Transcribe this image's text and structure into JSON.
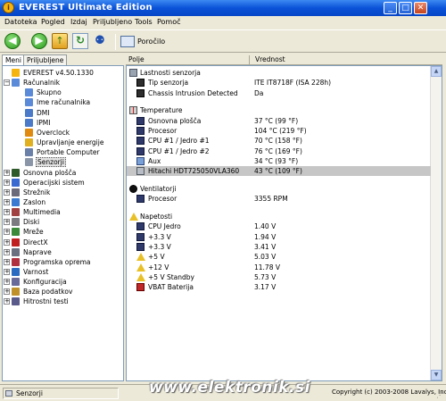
{
  "window": {
    "title": "EVEREST Ultimate Edition",
    "app_icon": "i"
  },
  "window_buttons": {
    "minimize": "_",
    "maximize": "□",
    "close": "✕"
  },
  "menu": [
    "Datoteka",
    "Pogled",
    "Izdaj",
    "Priljubljeno",
    "Tools",
    "Pomoč"
  ],
  "toolbar": {
    "back": "◀",
    "forward": "▶",
    "up": "↑",
    "refresh": "↻",
    "users": "⚉",
    "report_label": "Poročilo"
  },
  "tabs": [
    "Meni",
    "Priljubljene"
  ],
  "tree": [
    {
      "label": "EVEREST v4.50.1330",
      "icon": "everest-icon",
      "depth": 0,
      "expander": ""
    },
    {
      "label": "Računalnik",
      "icon": "computer-icon",
      "depth": 0,
      "expander": "−"
    },
    {
      "label": "Skupno",
      "icon": "computer-icon",
      "depth": 1,
      "expander": ""
    },
    {
      "label": "Ime računalnika",
      "icon": "computer-icon",
      "depth": 1,
      "expander": ""
    },
    {
      "label": "DMI",
      "icon": "dmi-icon",
      "depth": 1,
      "expander": ""
    },
    {
      "label": "IPMI",
      "icon": "ipmi-icon",
      "depth": 1,
      "expander": ""
    },
    {
      "label": "Overclock",
      "icon": "overclock-icon",
      "depth": 1,
      "expander": ""
    },
    {
      "label": "Upravljanje energije",
      "icon": "power-icon",
      "depth": 1,
      "expander": ""
    },
    {
      "label": "Portable Computer",
      "icon": "laptop-icon",
      "depth": 1,
      "expander": ""
    },
    {
      "label": "Senzorji",
      "icon": "sensor-icon",
      "depth": 1,
      "expander": "",
      "selected": true
    },
    {
      "label": "Osnovna plošča",
      "icon": "motherboard-icon",
      "depth": 0,
      "expander": "+"
    },
    {
      "label": "Operacijski sistem",
      "icon": "os-icon",
      "depth": 0,
      "expander": "+"
    },
    {
      "label": "Strežnik",
      "icon": "server-icon",
      "depth": 0,
      "expander": "+"
    },
    {
      "label": "Zaslon",
      "icon": "display-icon",
      "depth": 0,
      "expander": "+"
    },
    {
      "label": "Multimedia",
      "icon": "multimedia-icon",
      "depth": 0,
      "expander": "+"
    },
    {
      "label": "Diski",
      "icon": "disk-icon",
      "depth": 0,
      "expander": "+"
    },
    {
      "label": "Mreže",
      "icon": "network-icon",
      "depth": 0,
      "expander": "+"
    },
    {
      "label": "DirectX",
      "icon": "directx-icon",
      "depth": 0,
      "expander": "+"
    },
    {
      "label": "Naprave",
      "icon": "devices-icon",
      "depth": 0,
      "expander": "+"
    },
    {
      "label": "Programska oprema",
      "icon": "software-icon",
      "depth": 0,
      "expander": "+"
    },
    {
      "label": "Varnost",
      "icon": "security-icon",
      "depth": 0,
      "expander": "+"
    },
    {
      "label": "Konfiguracija",
      "icon": "config-icon",
      "depth": 0,
      "expander": "+"
    },
    {
      "label": "Baza podatkov",
      "icon": "database-icon",
      "depth": 0,
      "expander": "+"
    },
    {
      "label": "Hitrostni testi",
      "icon": "benchmark-icon",
      "depth": 0,
      "expander": "+"
    }
  ],
  "columns": {
    "field": "Polje",
    "value": "Vrednost"
  },
  "sections": [
    {
      "title": "Lastnosti senzorja",
      "icon": "sensor-icon",
      "rows": [
        {
          "field": "Tip senzorja",
          "value": "ITE IT8718F (ISA 228h)",
          "icon": "chip-icon"
        },
        {
          "field": "Chassis Intrusion Detected",
          "value": "Da",
          "icon": "chip-icon"
        }
      ]
    },
    {
      "title": "Temperature",
      "icon": "thermometer-icon",
      "rows": [
        {
          "field": "Osnovna plošča",
          "value": "37 °C  (99 °F)",
          "icon": "board-icon"
        },
        {
          "field": "Procesor",
          "value": "104 °C  (219 °F)",
          "icon": "board-icon"
        },
        {
          "field": "CPU #1 / Jedro #1",
          "value": "70 °C  (158 °F)",
          "icon": "board-icon"
        },
        {
          "field": "CPU #1 / Jedro #2",
          "value": "76 °C  (169 °F)",
          "icon": "board-icon"
        },
        {
          "field": "Aux",
          "value": "34 °C  (93 °F)",
          "icon": "aux-icon"
        },
        {
          "field": "Hitachi HDT725050VLA360",
          "value": "43 °C  (109 °F)",
          "icon": "hdd-icon",
          "highlighted": true
        }
      ]
    },
    {
      "title": "Ventilatorji",
      "icon": "fan-icon",
      "rows": [
        {
          "field": "Procesor",
          "value": "3355 RPM",
          "icon": "board-icon"
        }
      ]
    },
    {
      "title": "Napetosti",
      "icon": "voltage-icon",
      "rows": [
        {
          "field": "CPU Jedro",
          "value": "1.40 V",
          "icon": "board-icon"
        },
        {
          "field": "+3.3 V",
          "value": "1.94 V",
          "icon": "board-icon"
        },
        {
          "field": "+3.3 V",
          "value": "3.41 V",
          "icon": "board-icon"
        },
        {
          "field": "+5 V",
          "value": "5.03 V",
          "icon": "warning-icon"
        },
        {
          "field": "+12 V",
          "value": "11.78 V",
          "icon": "warning-icon"
        },
        {
          "field": "+5 V Standby",
          "value": "5.73 V",
          "icon": "warning-icon"
        },
        {
          "field": "VBAT Baterija",
          "value": "3.17 V",
          "icon": "battery-icon"
        }
      ]
    }
  ],
  "scroll": {
    "up": "▲",
    "down": "▼"
  },
  "status": {
    "left": "Senzorji",
    "right": "Copyright (c) 2003-2008 Lavalys, Inc.",
    "grip": "⋰"
  },
  "watermark": "www.elektronik.si"
}
